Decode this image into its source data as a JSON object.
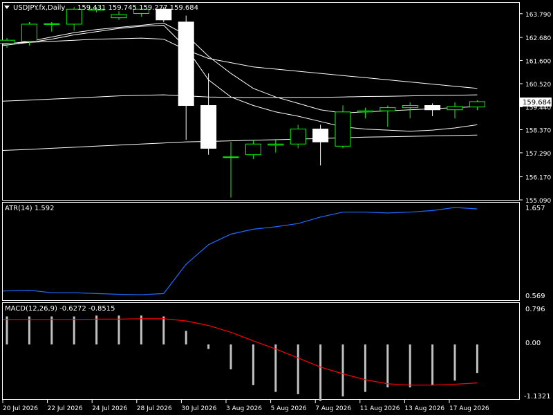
{
  "header": {
    "symbol": "USDJPY.fx,Daily",
    "ohlc": "159.431 159.745 159.277 159.684"
  },
  "colors": {
    "background": "#000000",
    "frame": "#ffffff",
    "bull_candle": "#00ff00",
    "bear_candle_fill": "#ffffff",
    "ma_lines": "#ffffff",
    "atr_line": "#1e6cff",
    "macd_signal": "#ff0000",
    "macd_hist": "#c0c0c0",
    "current_price_box": "#ffffff"
  },
  "price_axis": {
    "ticks": [
      "163.790",
      "162.680",
      "161.600",
      "160.520",
      "159.440",
      "158.370",
      "157.290",
      "156.170",
      "155.090"
    ],
    "current_price": "159.684"
  },
  "atr_panel": {
    "label": "ATR(14) 1.592",
    "ticks": [
      "1.657",
      "0.569"
    ]
  },
  "macd_panel": {
    "label": "MACD(12,26,9) -0.6272 -0.8515",
    "ticks": [
      "0.796",
      "0.00",
      "-1.1321"
    ]
  },
  "time_axis": {
    "labels": [
      "20 Jul 2026",
      "22 Jul 2026",
      "24 Jul 2026",
      "28 Jul 2026",
      "30 Jul 2026",
      "3 Aug 2026",
      "5 Aug 2026",
      "7 Aug 2026",
      "11 Aug 2026",
      "13 Aug 2026",
      "17 Aug 2026"
    ]
  },
  "chart_data": [
    {
      "type": "candlestick",
      "title": "USDJPY.fx,Daily",
      "ylim": [
        155.09,
        164.3
      ],
      "candles": [
        {
          "o": 162.4,
          "h": 162.65,
          "l": 162.2,
          "c": 162.55
        },
        {
          "o": 162.5,
          "h": 163.4,
          "l": 162.3,
          "c": 163.3
        },
        {
          "o": 163.3,
          "h": 163.4,
          "l": 162.95,
          "c": 163.32
        },
        {
          "o": 163.3,
          "h": 164.1,
          "l": 163.0,
          "c": 164.0
        },
        {
          "o": 163.95,
          "h": 164.1,
          "l": 163.85,
          "c": 164.0
        },
        {
          "o": 163.6,
          "h": 163.9,
          "l": 163.5,
          "c": 163.75
        },
        {
          "o": 163.8,
          "h": 164.05,
          "l": 163.65,
          "c": 164.0
        },
        {
          "o": 164.0,
          "h": 164.1,
          "l": 163.4,
          "c": 163.5
        },
        {
          "o": 163.4,
          "h": 163.7,
          "l": 157.9,
          "c": 159.5
        },
        {
          "o": 159.5,
          "h": 161.0,
          "l": 157.2,
          "c": 157.5
        },
        {
          "o": 157.1,
          "h": 157.8,
          "l": 155.2,
          "c": 157.1
        },
        {
          "o": 157.2,
          "h": 157.9,
          "l": 157.0,
          "c": 157.7
        },
        {
          "o": 157.65,
          "h": 157.9,
          "l": 157.3,
          "c": 157.7
        },
        {
          "o": 157.7,
          "h": 158.6,
          "l": 157.5,
          "c": 158.4
        },
        {
          "o": 158.4,
          "h": 158.6,
          "l": 156.7,
          "c": 157.8
        },
        {
          "o": 157.6,
          "h": 159.5,
          "l": 157.5,
          "c": 159.2
        },
        {
          "o": 159.2,
          "h": 159.4,
          "l": 158.9,
          "c": 159.25
        },
        {
          "o": 159.25,
          "h": 159.5,
          "l": 158.5,
          "c": 159.4
        },
        {
          "o": 159.4,
          "h": 159.65,
          "l": 158.9,
          "c": 159.5
        },
        {
          "o": 159.5,
          "h": 159.6,
          "l": 159.0,
          "c": 159.3
        },
        {
          "o": 159.3,
          "h": 159.65,
          "l": 158.9,
          "c": 159.45
        },
        {
          "o": 159.43,
          "h": 159.75,
          "l": 159.28,
          "c": 159.68
        }
      ],
      "moving_averages": [
        {
          "name": "",
          "values": [
            162.3,
            162.45,
            162.6,
            162.8,
            162.95,
            163.1,
            163.2,
            163.25,
            162.2,
            160.7,
            159.9,
            159.5,
            159.2,
            159.0,
            158.75,
            158.5,
            158.4,
            158.35,
            158.3,
            158.35,
            158.45,
            158.6
          ]
        },
        {
          "name": "",
          "values": [
            162.35,
            162.5,
            162.7,
            162.9,
            163.05,
            163.15,
            163.25,
            163.35,
            162.8,
            161.8,
            161.0,
            160.3,
            159.9,
            159.6,
            159.3,
            159.15,
            159.2,
            159.25,
            159.3,
            159.35,
            159.4,
            159.45
          ]
        },
        {
          "name": "",
          "values": [
            162.4,
            162.45,
            162.5,
            162.55,
            162.6,
            162.62,
            162.65,
            162.6,
            162.1,
            161.7,
            161.5,
            161.3,
            161.2,
            161.1,
            161.0,
            160.9,
            160.8,
            160.7,
            160.6,
            160.5,
            160.4,
            160.3
          ]
        },
        {
          "name": "",
          "values": [
            159.7,
            159.75,
            159.8,
            159.85,
            159.9,
            159.95,
            159.98,
            160.0,
            159.95,
            159.9,
            159.88,
            159.87,
            159.87,
            159.88,
            159.88,
            159.9,
            159.92,
            159.93,
            159.95,
            159.97,
            159.98,
            160.0
          ]
        },
        {
          "name": "",
          "values": [
            157.4,
            157.45,
            157.5,
            157.55,
            157.6,
            157.65,
            157.7,
            157.75,
            157.8,
            157.82,
            157.85,
            157.88,
            157.9,
            157.93,
            157.96,
            157.99,
            158.02,
            158.04,
            158.06,
            158.08,
            158.1,
            158.12
          ]
        }
      ]
    },
    {
      "type": "line",
      "title": "ATR(14) 1.592",
      "ylim": [
        0.569,
        1.657
      ],
      "series": [
        {
          "name": "",
          "values": [
            0.63,
            0.64,
            0.61,
            0.61,
            0.6,
            0.59,
            0.585,
            0.6,
            0.96,
            1.2,
            1.33,
            1.39,
            1.42,
            1.46,
            1.54,
            1.6,
            1.6,
            1.59,
            1.6,
            1.62,
            1.657,
            1.64
          ]
        }
      ]
    },
    {
      "type": "bar",
      "title": "MACD(12,26,9) -0.6272 -0.8515",
      "ylim": [
        -1.1321,
        0.796
      ],
      "series": [
        {
          "name": "",
          "values": [
            0.62,
            0.62,
            0.62,
            0.62,
            0.64,
            0.64,
            0.64,
            0.62,
            0.3,
            -0.1,
            -0.55,
            -0.9,
            -1.05,
            -1.1,
            -1.25,
            -1.15,
            -1.05,
            -0.95,
            -0.95,
            -0.9,
            -0.8,
            -0.63
          ]
        },
        {
          "name": "",
          "values": [
            0.55,
            0.55,
            0.55,
            0.55,
            0.56,
            0.56,
            0.57,
            0.57,
            0.52,
            0.42,
            0.27,
            0.08,
            -0.1,
            -0.3,
            -0.5,
            -0.65,
            -0.78,
            -0.87,
            -0.9,
            -0.9,
            -0.88,
            -0.85
          ]
        }
      ]
    }
  ]
}
